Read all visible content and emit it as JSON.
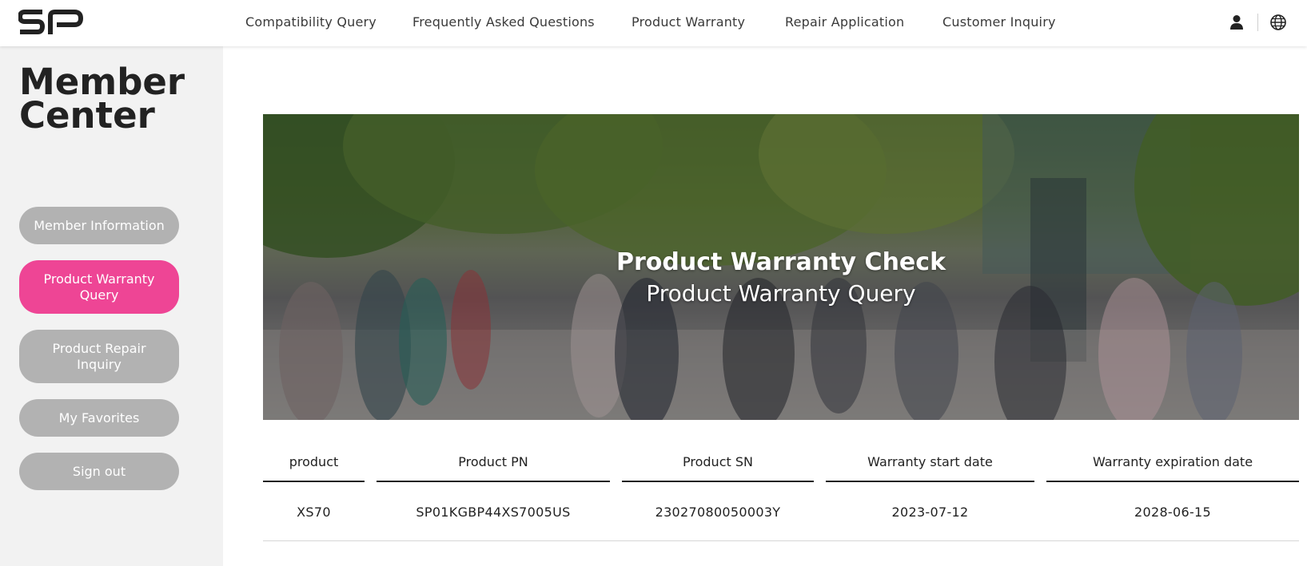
{
  "header": {
    "nav": [
      {
        "label": "Compatibility Query"
      },
      {
        "label": "Frequently Asked Questions"
      },
      {
        "label": "Product Warranty"
      },
      {
        "label": "Repair Application"
      },
      {
        "label": "Customer Inquiry"
      }
    ],
    "icons": [
      "user-icon",
      "globe-icon"
    ]
  },
  "sidebar": {
    "title": "Member Center",
    "items": [
      {
        "label": "Member Information",
        "active": false
      },
      {
        "label": "Product Warranty Query",
        "active": true
      },
      {
        "label": "Product Repair Inquiry",
        "active": false
      },
      {
        "label": "My Favorites",
        "active": false
      },
      {
        "label": "Sign out",
        "active": false
      }
    ]
  },
  "hero": {
    "title": "Product Warranty Check",
    "subtitle": "Product Warranty Query"
  },
  "table": {
    "columns": [
      "product",
      "Product PN",
      "Product SN",
      "Warranty start date",
      "Warranty expiration date"
    ],
    "rows": [
      [
        "XS70",
        "SP01KGBP44XS7005US",
        "23027080050003Y",
        "2023-07-12",
        "2028-06-15"
      ]
    ]
  },
  "colors": {
    "accent": "#ee4595",
    "sidebar_bg": "#f2f2f2",
    "button_gray": "#b2b2b2"
  }
}
